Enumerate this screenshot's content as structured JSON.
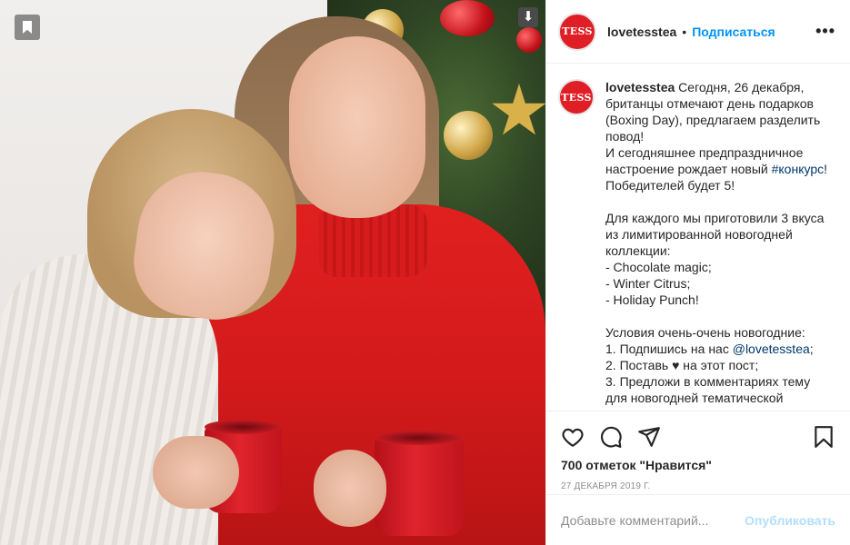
{
  "post": {
    "image_alt": "Two women in sweaters holding red mugs in front of a Christmas tree",
    "save_icon": "bookmark-icon",
    "download_icon": "download-arrow-icon"
  },
  "header": {
    "logo_text": "TESS",
    "username": "lovetesstea",
    "separator": "•",
    "follow_label": "Подписаться",
    "more_label": "•••"
  },
  "caption": {
    "username": "lovetesstea",
    "avatar_text": "TESS",
    "line_1": " Сегодня, 26 декабря, британцы отмечают день подарков (Boxing Day), предлагаем разделить повод!\nИ сегодняшнее предпраздничное настроение рождает новый ",
    "hashtag": "#конкурс",
    "line_2": "! Победителей будет 5!\n\nДля каждого мы приготовили 3 вкуса из лимитированной новогодней коллекции:\n- Chocolate magic;\n- Winter Citrus;\n- Holiday Punch!\n\nУсловия очень-очень новогодние:\n1. Подпишись на нас ",
    "mention": "@lovetesstea",
    "line_3": ";\n2. Поставь ♥ на этот пост;\n3. Предложи в комментариях тему для новогодней тематической"
  },
  "actions": {
    "like_icon": "heart-icon",
    "comment_icon": "comment-bubble-icon",
    "share_icon": "paper-plane-icon",
    "save_icon": "bookmark-icon",
    "likes_text": "700 отметок \"Нравится\"",
    "date_text": "27 декабря 2019 г."
  },
  "comment": {
    "placeholder": "Добавьте комментарий...",
    "publish_label": "Опубликовать"
  },
  "colors": {
    "accent": "#0095f6",
    "publish_disabled": "#b2dffc",
    "brand_red": "#e01e25",
    "text": "#262626",
    "muted": "#8e8e8e"
  }
}
